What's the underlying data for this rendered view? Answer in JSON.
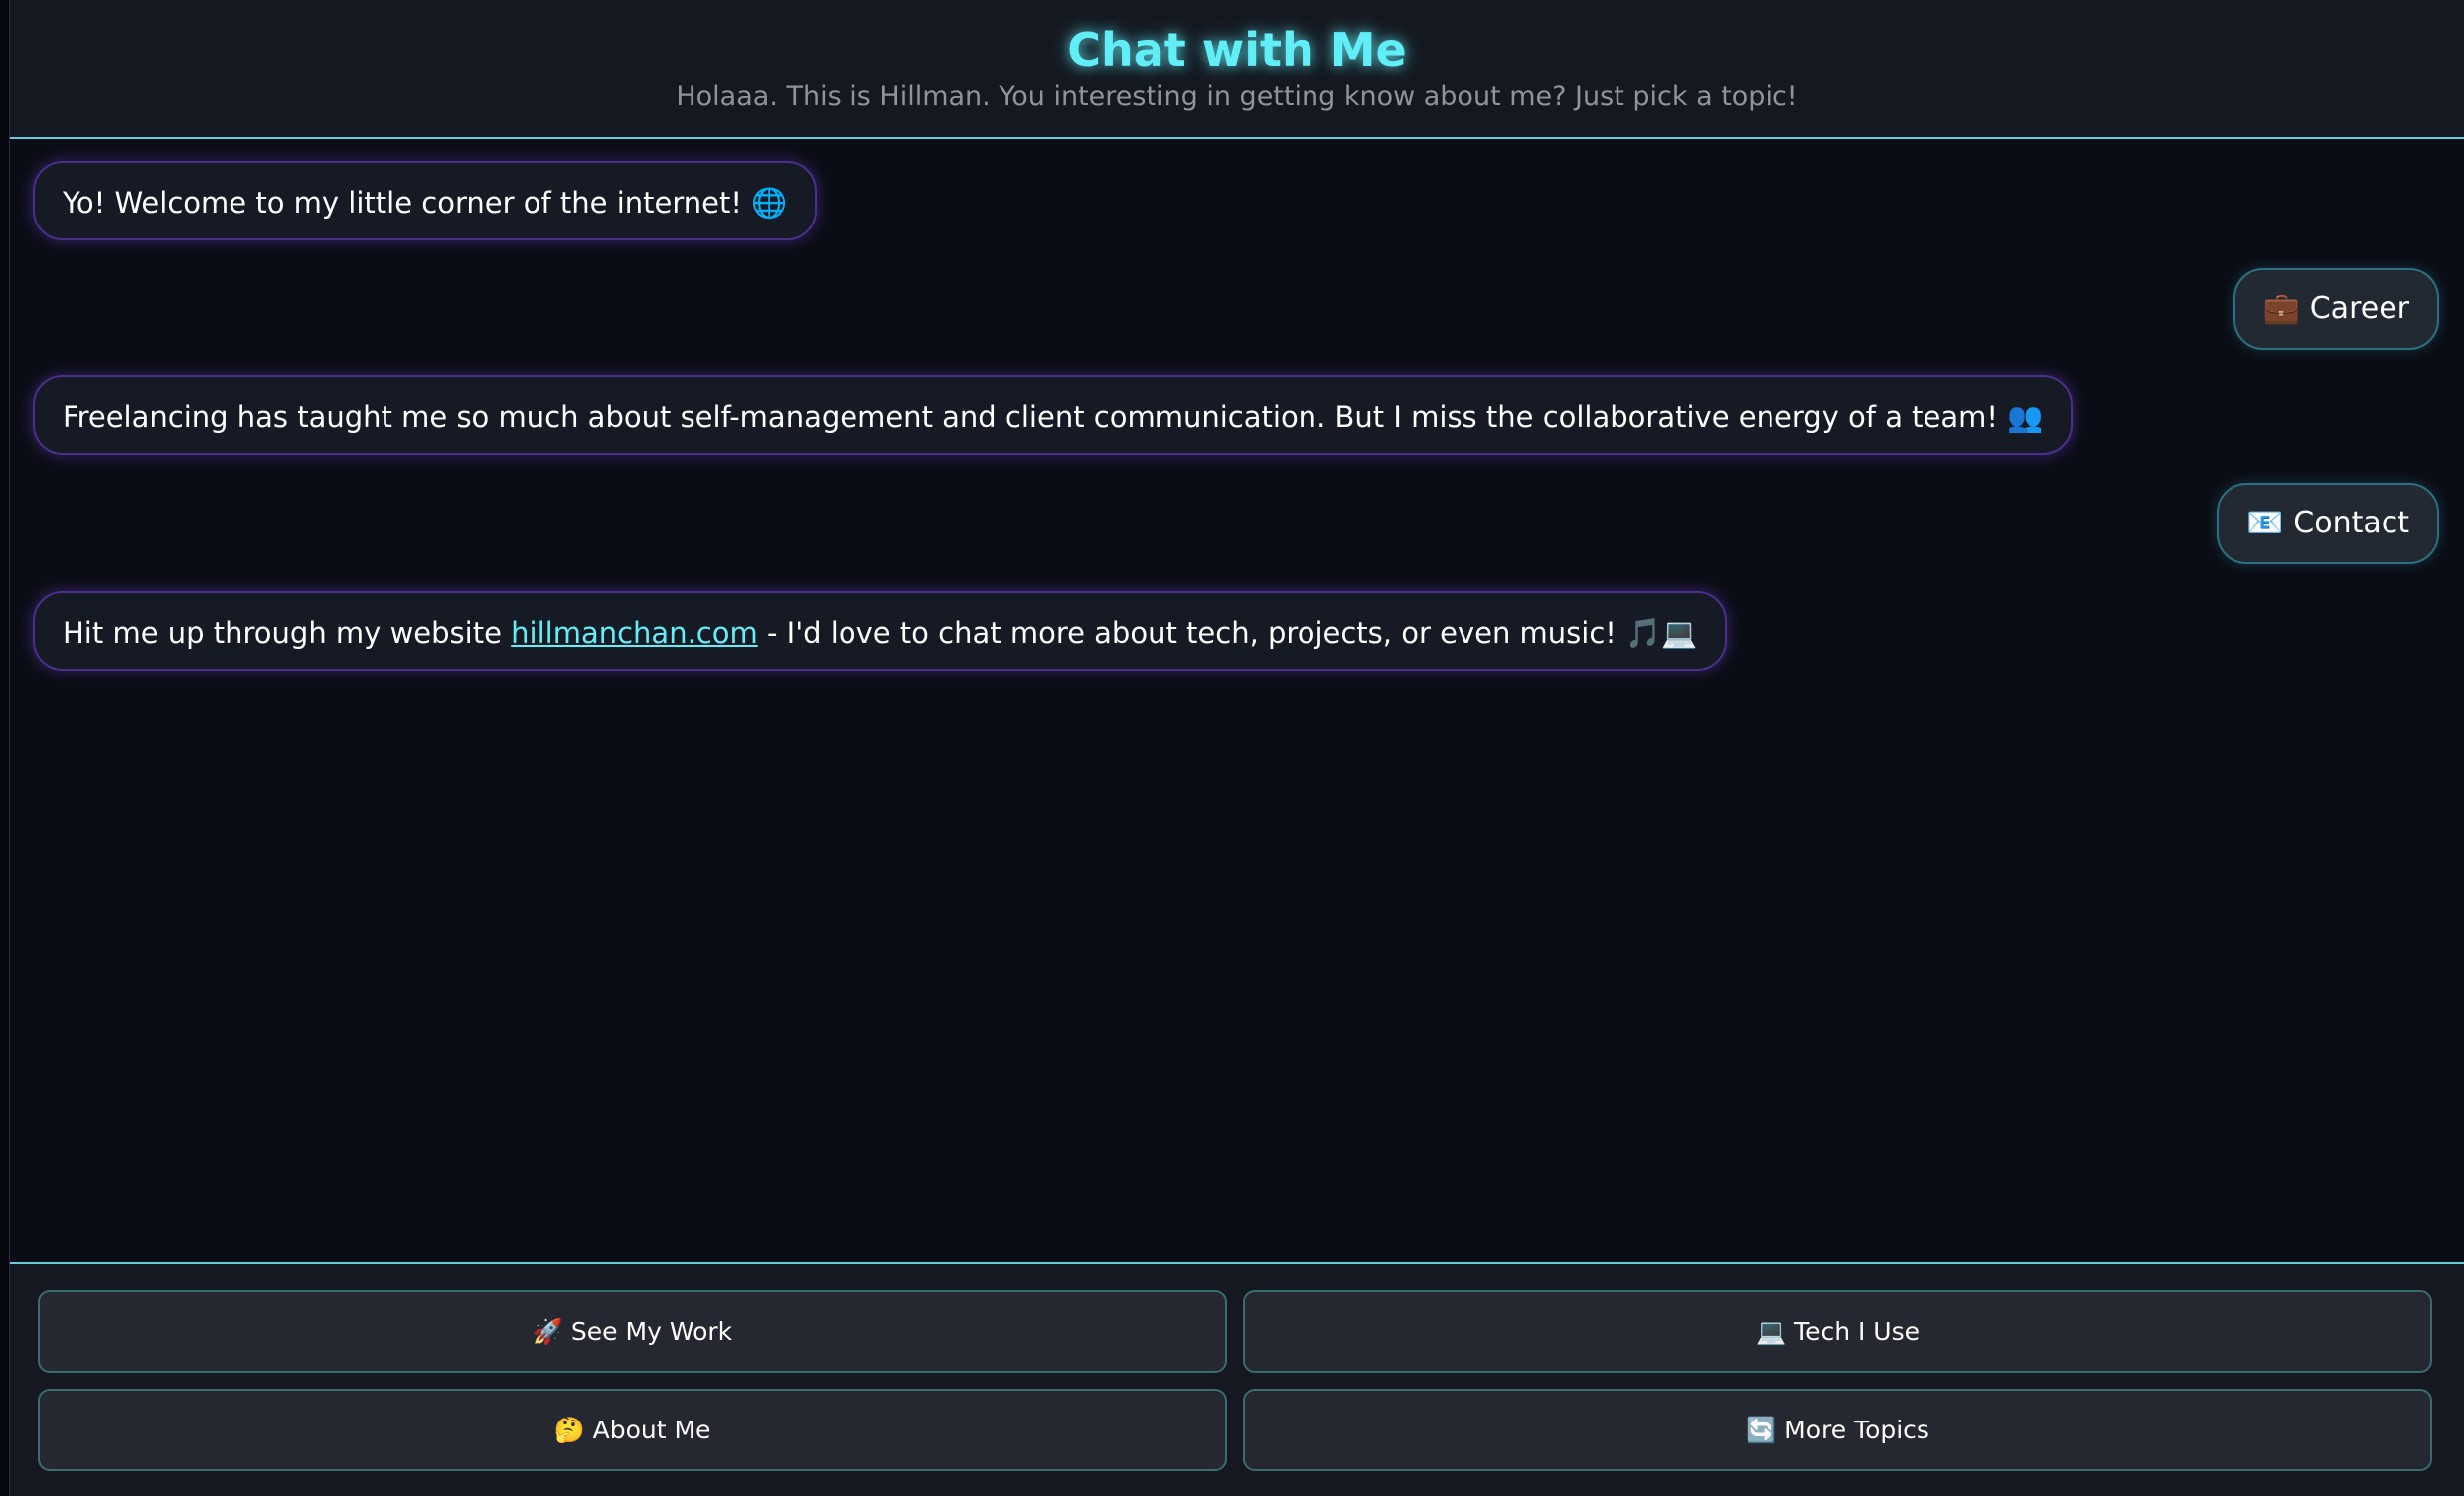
{
  "header": {
    "title": "Chat with Me",
    "subtitle": "Holaaa. This is Hillman. You interesting in getting know about me? Just pick a topic!"
  },
  "messages": [
    {
      "sender": "bot",
      "text": "Yo! Welcome to my little corner of the internet! 🌐"
    },
    {
      "sender": "user",
      "text": "💼 Career"
    },
    {
      "sender": "bot",
      "text": "Freelancing has taught me so much about self-management and client communication. But I miss the collaborative energy of a team! 👥"
    },
    {
      "sender": "user",
      "text": "📧 Contact"
    },
    {
      "sender": "bot",
      "text_before": "Hit me up through my website ",
      "link_text": "hillmanchan.com",
      "text_after": " - I'd love to chat more about tech, projects, or even music! 🎵💻"
    }
  ],
  "topics": [
    {
      "label": "🚀 See My Work"
    },
    {
      "label": "💻 Tech I Use"
    },
    {
      "label": "🤔 About Me"
    },
    {
      "label": "🔄 More Topics"
    }
  ],
  "colors": {
    "accent": "#62eef6",
    "background": "#0b0d16",
    "bot_bubble_border": "#4a2f8a",
    "user_bubble_border": "#2d6f7c"
  }
}
